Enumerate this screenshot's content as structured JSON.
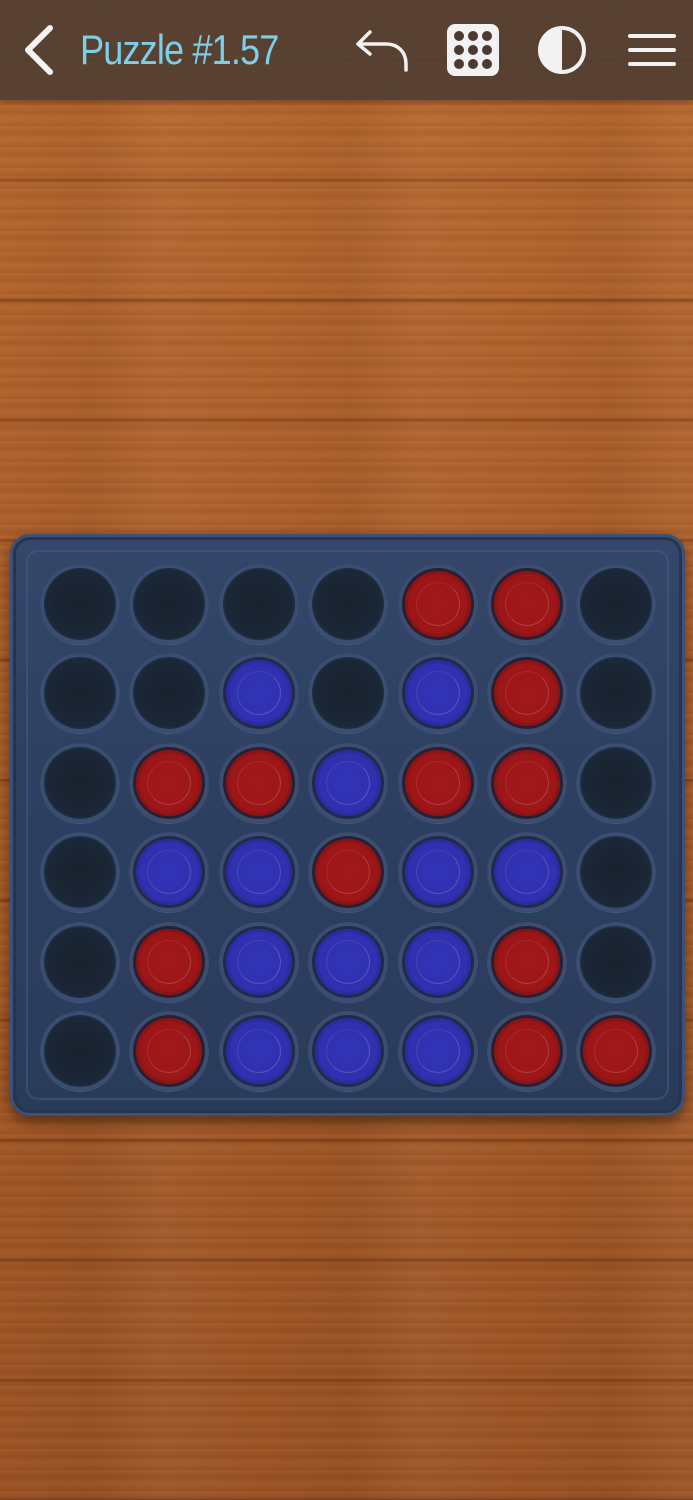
{
  "header": {
    "title": "Puzzle #1.57",
    "icons": [
      "chevron-left-icon",
      "undo-icon",
      "level-grid-icon",
      "contrast-icon",
      "hamburger-menu-icon"
    ]
  },
  "colors": {
    "title": "#7ccfe8",
    "red_piece": "#9b1517",
    "blue_piece": "#2e30ad",
    "empty_hole": "#1b2636",
    "board": "#2d3f60"
  },
  "board": {
    "columns": 7,
    "rows": 6,
    "cells": [
      [
        "empty",
        "empty",
        "empty",
        "empty",
        "red",
        "red",
        "empty"
      ],
      [
        "empty",
        "empty",
        "blue",
        "empty",
        "blue",
        "red",
        "empty"
      ],
      [
        "empty",
        "red",
        "red",
        "blue",
        "red",
        "red",
        "empty"
      ],
      [
        "empty",
        "blue",
        "blue",
        "red",
        "blue",
        "blue",
        "empty"
      ],
      [
        "empty",
        "red",
        "blue",
        "blue",
        "blue",
        "red",
        "empty"
      ],
      [
        "empty",
        "red",
        "blue",
        "blue",
        "blue",
        "red",
        "red"
      ]
    ]
  }
}
